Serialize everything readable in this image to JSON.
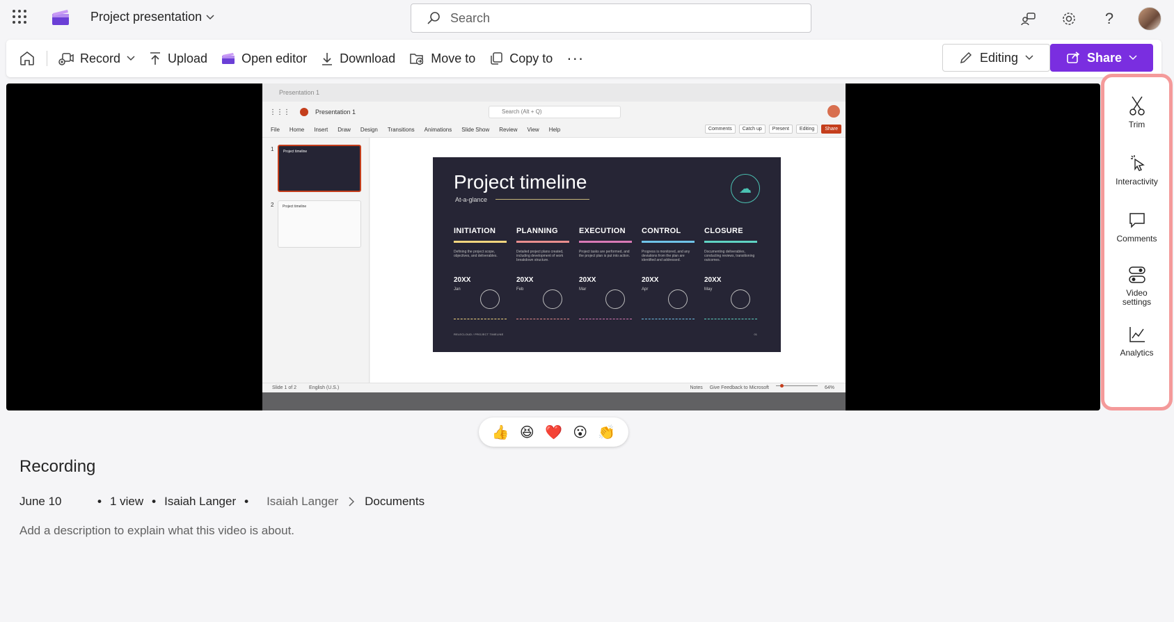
{
  "app": {
    "doc_title": "Project presentation",
    "search_placeholder": "Search"
  },
  "toolbar": {
    "record": "Record",
    "upload": "Upload",
    "open_editor": "Open editor",
    "download": "Download",
    "move_to": "Move to",
    "copy_to": "Copy to",
    "more": "···",
    "editing": "Editing",
    "share": "Share"
  },
  "video": {
    "ppt": {
      "titlebar": "Presentation 1",
      "doc_name": "Presentation 1",
      "search": "Search (Alt + Q)",
      "menu": [
        "File",
        "Home",
        "Insert",
        "Draw",
        "Design",
        "Transitions",
        "Animations",
        "Slide Show",
        "Review",
        "View",
        "Help"
      ],
      "buttons": [
        "Comments",
        "Catch up",
        "Present",
        "Editing",
        "Share"
      ],
      "thumb_title": "Project timeline",
      "slide_numbers": [
        "1",
        "2"
      ],
      "status_left": [
        "Slide 1 of 2",
        "English (U.S.)"
      ],
      "status_right": [
        "Notes",
        "Give Feedback to Microsoft",
        "64%"
      ]
    },
    "slide": {
      "title": "Project timeline",
      "subtitle": "At-a-glance",
      "footer": "RELECLOUD / PROJECT TIMELINE",
      "page": "01",
      "phases": [
        {
          "name": "INITIATION",
          "desc": "Defining the project scope, objectives, and deliverables.",
          "year": "20XX",
          "month": "Jan",
          "color": "#f2d57e"
        },
        {
          "name": "PLANNING",
          "desc": "Detailed project plans created, including development of work breakdown structure.",
          "year": "20XX",
          "month": "Feb",
          "color": "#e98e8e"
        },
        {
          "name": "EXECUTION",
          "desc": "Project tasks are performed, and the project plan is put into action.",
          "year": "20XX",
          "month": "Mar",
          "color": "#d979b6"
        },
        {
          "name": "CONTROL",
          "desc": "Progress is monitored, and any deviations from the plan are identified and addressed.",
          "year": "20XX",
          "month": "Apr",
          "color": "#6fc3e8"
        },
        {
          "name": "CLOSURE",
          "desc": "Documenting deliverables, conducting reviews, transitioning outcomes.",
          "year": "20XX",
          "month": "May",
          "color": "#5fd3c3"
        }
      ]
    }
  },
  "tools": [
    {
      "label": "Trim",
      "icon": "scissors-icon"
    },
    {
      "label": "Interactivity",
      "icon": "pointer-click-icon"
    },
    {
      "label": "Comments",
      "icon": "comment-icon"
    },
    {
      "label": "Video settings",
      "icon": "settings-toggle-icon"
    },
    {
      "label": "Analytics",
      "icon": "chart-line-icon"
    }
  ],
  "reactions": [
    "👍",
    "😆",
    "❤️",
    "😮",
    "👏"
  ],
  "info": {
    "title": "Recording",
    "date": "June 10",
    "views": "1 view",
    "owner": "Isaiah Langer",
    "breadcrumb_parent": "Isaiah Langer",
    "breadcrumb_current": "Documents",
    "description_placeholder": "Add a description to explain what this video is about."
  },
  "colors": {
    "accent": "#7a2ee0",
    "highlight_border": "#f49a9a",
    "slide_background": "#262535"
  }
}
